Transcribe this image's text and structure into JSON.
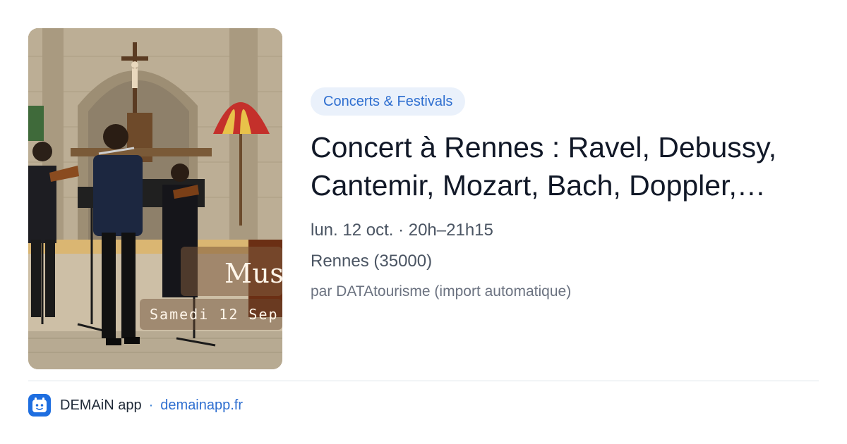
{
  "event": {
    "category": "Concerts & Festivals",
    "title": "Concert à Rennes : Ravel, Debussy, Cantemir, Mozart, Bach, Doppler,…",
    "date_time": "lun. 12 oct. · 20h–21h15",
    "location": "Rennes (35000)",
    "source": "par DATAtourisme (import automatique)",
    "image": {
      "overlay_line_1": "Musicâ",
      "overlay_line_2": "Samedi 12 Sep"
    }
  },
  "footer": {
    "app_name": "DEMAiN app",
    "separator": "·",
    "link": "demainapp.fr",
    "logo_icon": "app-logo-icon"
  },
  "colors": {
    "accent": "#2f6fd0",
    "badge_bg": "#eaf1fb",
    "logo_bg": "#1e6ee0"
  }
}
